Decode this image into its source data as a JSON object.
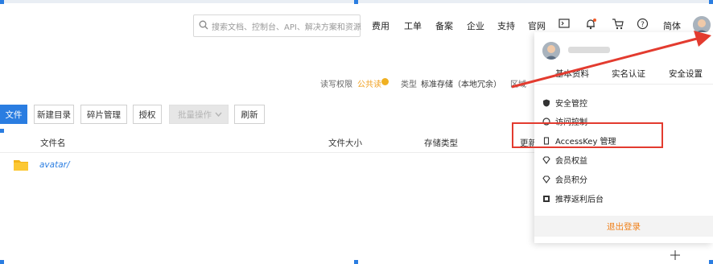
{
  "header": {
    "search_placeholder": "搜索文档、控制台、API、解决方案和资源",
    "nav": [
      "费用",
      "工单",
      "备案",
      "企业",
      "支持",
      "官网"
    ],
    "lang": "简体"
  },
  "bucket_info": {
    "rw_label": "读写权限",
    "rw_value": "公共读",
    "type_label": "类型",
    "type_value": "标准存储（本地冗余）",
    "region_label": "区域"
  },
  "toolbar": {
    "upload_label": "文件",
    "new_dir_label": "新建目录",
    "fragments_label": "碎片管理",
    "auth_label": "授权",
    "batch_label": "批量操作",
    "refresh_label": "刷新"
  },
  "table": {
    "columns": [
      "文件名",
      "文件大小",
      "存储类型",
      "更新"
    ],
    "rows": [
      {
        "name": "avatar/"
      }
    ]
  },
  "user_menu": {
    "username": "",
    "links": [
      "基本资料",
      "实名认证",
      "安全设置"
    ],
    "items": [
      {
        "label": "安全管控",
        "icon": "shield-icon"
      },
      {
        "label": "访问控制",
        "icon": "access-control-icon"
      },
      {
        "label": "AccessKey 管理",
        "icon": "key-icon"
      },
      {
        "label": "会员权益",
        "icon": "diamond-icon"
      },
      {
        "label": "会员积分",
        "icon": "points-icon"
      },
      {
        "label": "推荐返利后台",
        "icon": "gift-icon"
      }
    ],
    "logout_label": "退出登录"
  },
  "colors": {
    "primary": "#2a7de1",
    "highlight": "#e33b2f",
    "accent_orange": "#f08019"
  }
}
